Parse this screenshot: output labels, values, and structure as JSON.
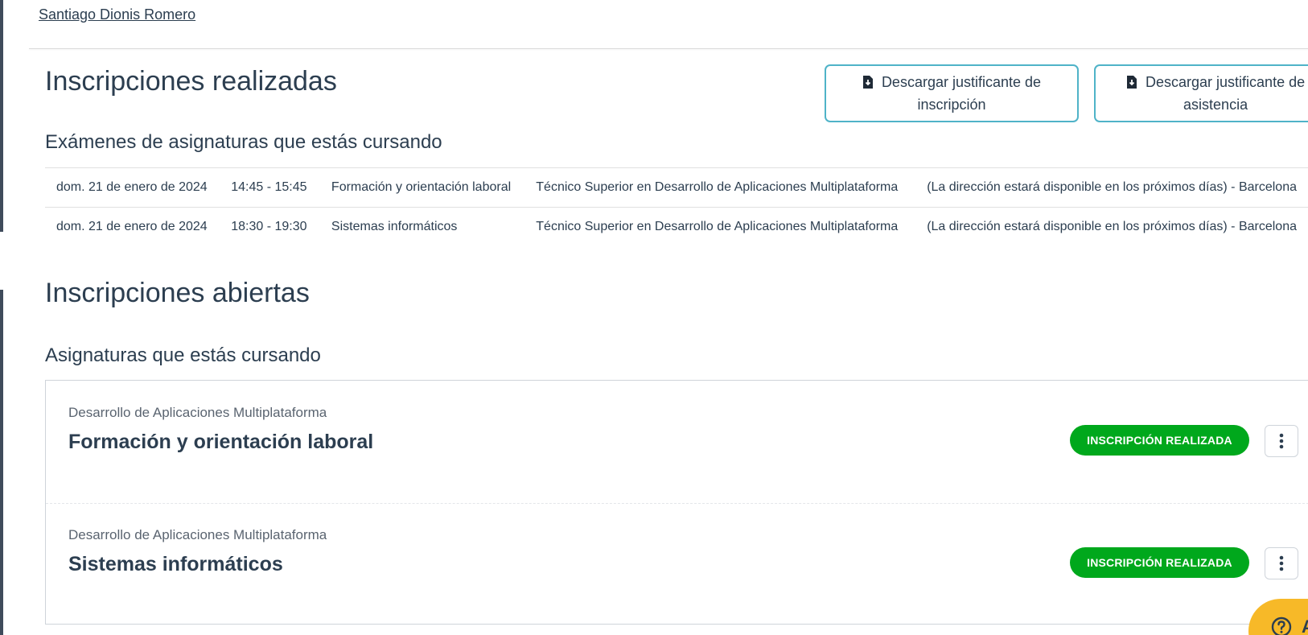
{
  "header": {
    "user_name": "Santiago Dionis Romero"
  },
  "realizadas": {
    "title": "Inscripciones realizadas",
    "buttons": {
      "inscripcion": {
        "line1": "Descargar justificante de",
        "line2": "inscripción",
        "icon": "file-download-icon"
      },
      "asistencia": {
        "line1": "Descargar justificante de",
        "line2": "asistencia",
        "icon": "file-download-icon"
      }
    },
    "exams_title": "Exámenes de asignaturas que estás cursando",
    "exams": [
      {
        "date": "dom. 21 de enero de 2024",
        "time": "14:45 - 15:45",
        "subject": "Formación y orientación laboral",
        "degree": "Técnico Superior en Desarrollo de Aplicaciones Multiplataforma",
        "location": "(La dirección estará disponible en los próximos días) - Barcelona"
      },
      {
        "date": "dom. 21 de enero de 2024",
        "time": "18:30 - 19:30",
        "subject": "Sistemas informáticos",
        "degree": "Técnico Superior en Desarrollo de Aplicaciones Multiplataforma",
        "location": "(La dirección estará disponible en los próximos días) - Barcelona"
      }
    ]
  },
  "abiertas": {
    "title": "Inscripciones abiertas",
    "subjects_title": "Asignaturas que estás cursando",
    "subjects": [
      {
        "degree": "Desarrollo de Aplicaciones Multiplataforma",
        "name": "Formación y orientación laboral",
        "status": "INSCRIPCIÓN REALIZADA"
      },
      {
        "degree": "Desarrollo de Aplicaciones Multiplataforma",
        "name": "Sistemas informáticos",
        "status": "INSCRIPCIÓN REALIZADA"
      }
    ]
  },
  "help": {
    "label": "A",
    "icon": "question-circle-icon"
  },
  "colors": {
    "accent_border": "#4fb3c8",
    "status_green": "#00a81c",
    "help_yellow": "#f7b928",
    "text_dark": "#2c3e50"
  }
}
